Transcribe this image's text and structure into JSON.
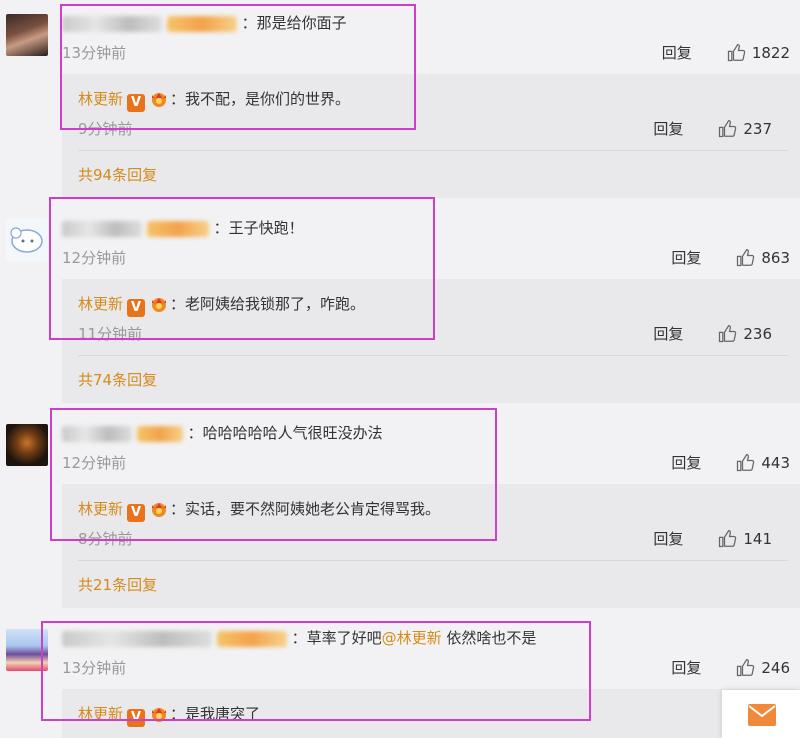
{
  "ui": {
    "reply_label": "回复"
  },
  "comments": [
    {
      "text": "：那是给你面子",
      "time": "13分钟前",
      "likes": "1822",
      "reply": {
        "author": "林更新",
        "text": "：我不配，是你们的世界。",
        "time": "9分钟前",
        "likes": "237"
      },
      "more": "共94条回复"
    },
    {
      "text": "：王子快跑！",
      "time": "12分钟前",
      "likes": "863",
      "reply": {
        "author": "林更新",
        "text": "：老阿姨给我锁那了，咋跑。",
        "time": "11分钟前",
        "likes": "236"
      },
      "more": "共74条回复"
    },
    {
      "text": "：哈哈哈哈哈人气很旺没办法",
      "time": "12分钟前",
      "likes": "443",
      "reply": {
        "author": "林更新",
        "text": "：实话，要不然阿姨她老公肯定得骂我。",
        "time": "8分钟前",
        "likes": "141"
      },
      "more": "共21条回复"
    },
    {
      "text_before": "：草率了好吧",
      "mention": "@林更新",
      "text_after": " 依然啥也不是",
      "time": "13分钟前",
      "likes": "246",
      "reply": {
        "author": "林更新",
        "text": "：是我唐突了"
      }
    }
  ],
  "icons": {
    "thumb": "thumbs-up-icon",
    "verified": "verified-v-icon",
    "crown": "crown-badge-icon",
    "mail": "mail-icon"
  },
  "colors": {
    "accent": "#d58a1a",
    "highlight_box": "#cc3fc6",
    "verified": "#e8731a"
  }
}
